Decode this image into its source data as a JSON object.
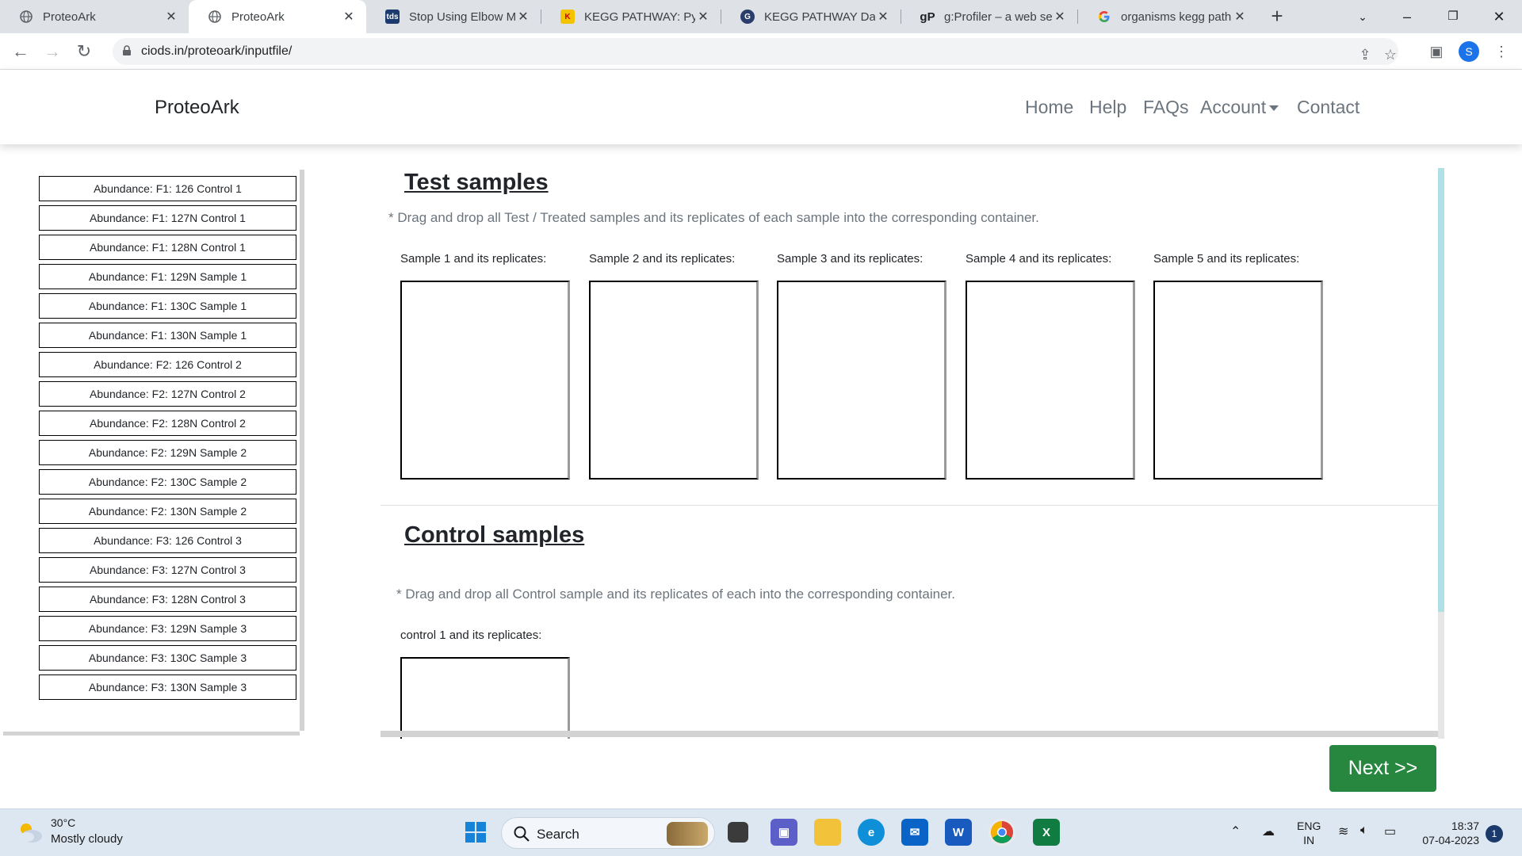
{
  "browser": {
    "tabs": [
      {
        "title": "ProteoArk",
        "favicon": "globe-icon",
        "active": false
      },
      {
        "title": "ProteoArk",
        "favicon": "globe-icon",
        "active": true
      },
      {
        "title": "Stop Using Elbow Me",
        "favicon": "tds-icon",
        "active": false
      },
      {
        "title": "KEGG PATHWAY: Pyru",
        "favicon": "kegg-icon",
        "active": false
      },
      {
        "title": "KEGG PATHWAY Datal",
        "favicon": "genome-icon",
        "active": false
      },
      {
        "title": "g:Profiler – a web serv",
        "favicon": "gprofiler-icon",
        "active": false
      },
      {
        "title": "organisms kegg path",
        "favicon": "google-icon",
        "active": false
      }
    ],
    "url": "ciods.in/proteoark/inputfile/",
    "profile_initial": "S"
  },
  "navbar": {
    "brand": "ProteoArk",
    "links": [
      "Home",
      "Help",
      "FAQs",
      "Account",
      "Contact"
    ]
  },
  "sidebar": {
    "samples": [
      "Abundance: F1: 126 Control 1",
      "Abundance: F1: 127N Control 1",
      "Abundance: F1: 128N Control 1",
      "Abundance: F1: 129N Sample 1",
      "Abundance: F1: 130C Sample 1",
      "Abundance: F1: 130N Sample 1",
      "Abundance: F2: 126 Control 2",
      "Abundance: F2: 127N Control 2",
      "Abundance: F2: 128N Control 2",
      "Abundance: F2: 129N Sample 2",
      "Abundance: F2: 130C Sample 2",
      "Abundance: F2: 130N Sample 2",
      "Abundance: F3: 126 Control 3",
      "Abundance: F3: 127N Control 3",
      "Abundance: F3: 128N Control 3",
      "Abundance: F3: 129N Sample 3",
      "Abundance: F3: 130C Sample 3",
      "Abundance: F3: 130N Sample 3"
    ]
  },
  "test_section": {
    "title": "Test samples",
    "hint": "* Drag and drop all Test / Treated samples and its replicates of each sample into the corresponding container.",
    "containers": [
      "Sample 1 and its replicates:",
      "Sample 2 and its replicates:",
      "Sample 3 and its replicates:",
      "Sample 4 and its replicates:",
      "Sample 5 and its replicates:"
    ]
  },
  "control_section": {
    "title": "Control samples",
    "hint": "* Drag and drop all Control sample and its replicates of each into the corresponding container.",
    "containers": [
      "control 1 and its replicates:"
    ]
  },
  "next_button": "Next >>",
  "taskbar": {
    "weather_temp": "30°C",
    "weather_desc": "Mostly cloudy",
    "search_label": "Search",
    "lang_line1": "ENG",
    "lang_line2": "IN",
    "time": "18:37",
    "date": "07-04-2023",
    "notification_count": "1"
  },
  "colors": {
    "next_button": "#28873f",
    "scroll_accent": "#b0e0e6",
    "tab_bar": "#dee1e6"
  }
}
